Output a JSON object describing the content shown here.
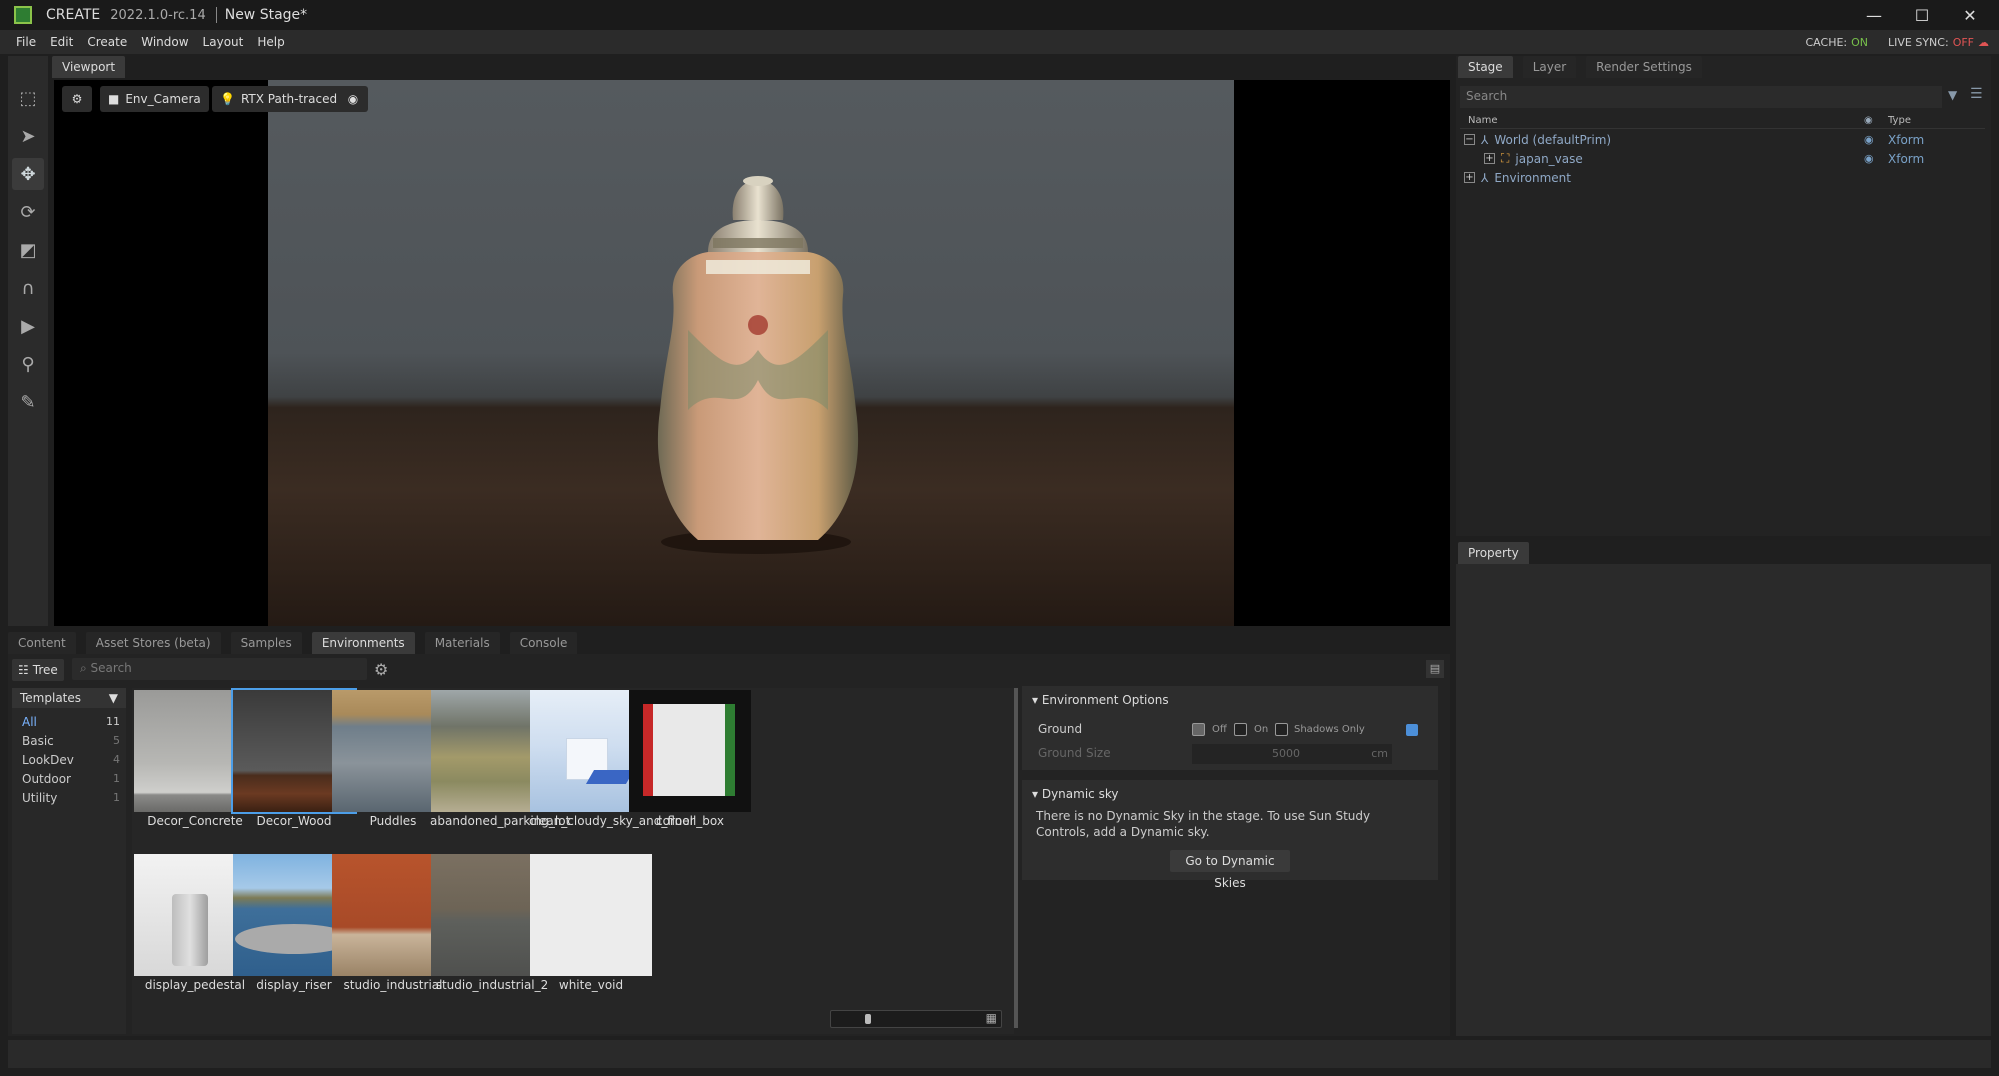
{
  "titlebar": {
    "app": "CREATE",
    "version": "2022.1.0-rc.14",
    "document": "New Stage*",
    "minimize": "—",
    "maximize": "☐",
    "close": "✕"
  },
  "menu": [
    "File",
    "Edit",
    "Create",
    "Window",
    "Layout",
    "Help"
  ],
  "status": {
    "cache_label": "CACHE:",
    "cache_value": "ON",
    "live_sync_label": "LIVE SYNC:",
    "live_sync_value": "OFF"
  },
  "viewport": {
    "tab": "Viewport",
    "camera": "Env_Camera",
    "renderer": "RTX Path-traced"
  },
  "stage": {
    "tabs": [
      "Stage",
      "Layer",
      "Render Settings"
    ],
    "search_placeholder": "Search",
    "columns": {
      "name": "Name",
      "type": "Type"
    },
    "rows": [
      {
        "name": "World (defaultPrim)",
        "type": "Xform",
        "expander": "−"
      },
      {
        "name": "japan_vase",
        "type": "Xform",
        "expander": "+"
      },
      {
        "name": "Environment",
        "type": "",
        "expander": "+"
      }
    ]
  },
  "property": {
    "tab": "Property"
  },
  "bottom": {
    "tabs": [
      "Content",
      "Asset Stores (beta)",
      "Samples",
      "Environments",
      "Materials",
      "Console"
    ],
    "tree_button": "Tree",
    "search_placeholder": "Search",
    "templates": {
      "header": "Templates",
      "items": [
        {
          "label": "All",
          "count": "11"
        },
        {
          "label": "Basic",
          "count": "5"
        },
        {
          "label": "LookDev",
          "count": "4"
        },
        {
          "label": "Outdoor",
          "count": "1"
        },
        {
          "label": "Utility",
          "count": "1"
        }
      ]
    },
    "assets": [
      "Decor_Concrete",
      "Decor_Wood",
      "Puddles",
      "abandoned_parking_lot",
      "clean_cloudy_sky_and_floor",
      "cornell_box",
      "display_pedestal",
      "display_riser",
      "studio_industrial",
      "studio_industrial_2",
      "white_void"
    ]
  },
  "env_options": {
    "title": "Environment Options",
    "ground_label": "Ground",
    "off": "Off",
    "on": "On",
    "shadows_only": "Shadows Only",
    "ground_size_label": "Ground Size",
    "ground_size_value": "5000",
    "ground_size_unit": "cm"
  },
  "dynamic_sky": {
    "title": "Dynamic sky",
    "message": "There is no Dynamic Sky in the stage. To use Sun Study Controls, add a Dynamic sky.",
    "button": "Go to Dynamic Skies"
  },
  "colors": {
    "accent": "#4c9ee8",
    "on": "#77c04b",
    "off": "#e05454"
  }
}
